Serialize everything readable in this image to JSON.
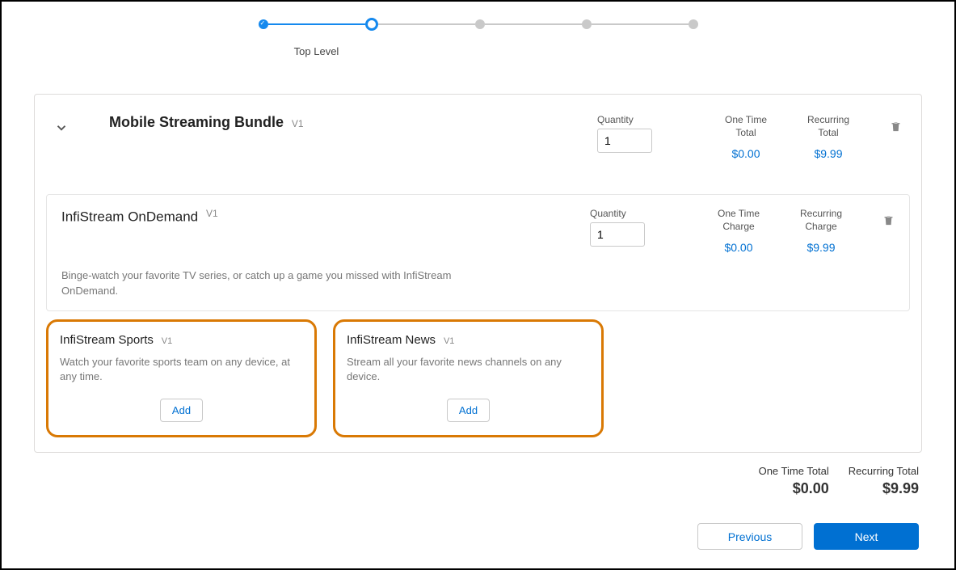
{
  "stepper": {
    "label": "Top Level"
  },
  "bundle": {
    "title": "Mobile Streaming Bundle",
    "version": "V1",
    "qty_label": "Quantity",
    "qty_value": "1",
    "one_time_lbl1": "One Time",
    "one_time_lbl2": "Total",
    "one_time_val": "$0.00",
    "recurring_lbl1": "Recurring",
    "recurring_lbl2": "Total",
    "recurring_val": "$9.99"
  },
  "item": {
    "title": "InfiStream OnDemand",
    "version": "V1",
    "qty_label": "Quantity",
    "qty_value": "1",
    "one_time_lbl1": "One Time",
    "one_time_lbl2": "Charge",
    "one_time_val": "$0.00",
    "recurring_lbl1": "Recurring",
    "recurring_lbl2": "Charge",
    "recurring_val": "$9.99",
    "desc": "Binge-watch your favorite TV series, or catch up a game you missed with InfiStream OnDemand."
  },
  "addons": [
    {
      "title": "InfiStream Sports",
      "version": "V1",
      "desc": "Watch your favorite sports team on any device, at any time.",
      "btn": "Add"
    },
    {
      "title": "InfiStream News",
      "version": "V1",
      "desc": "Stream all your favorite news channels on any device.",
      "btn": "Add"
    }
  ],
  "footer": {
    "one_time_lbl": "One Time Total",
    "one_time_val": "$0.00",
    "recurring_lbl": "Recurring Total",
    "recurring_val": "$9.99",
    "prev": "Previous",
    "next": "Next"
  }
}
